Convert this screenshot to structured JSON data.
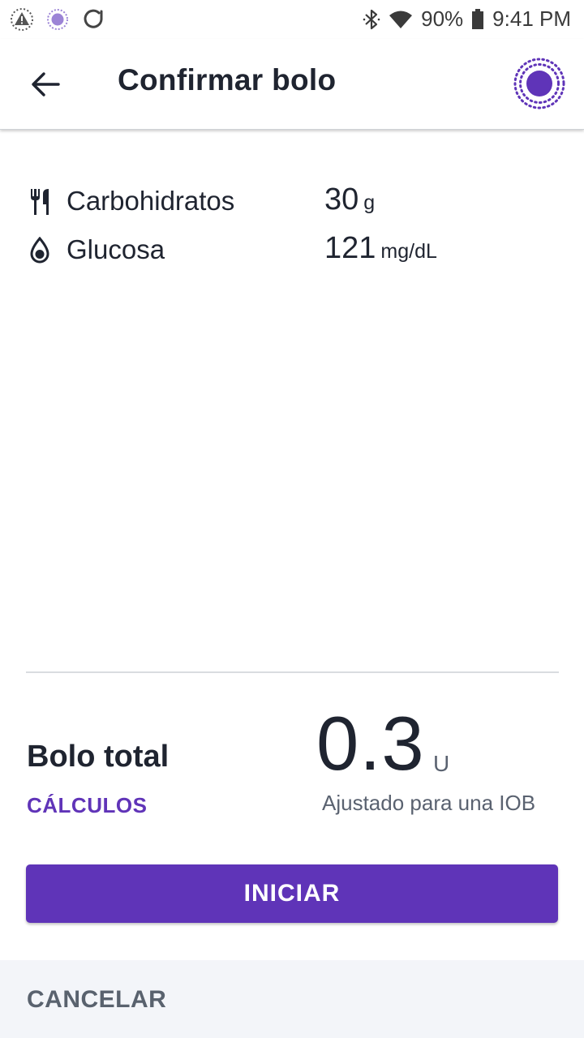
{
  "status_bar": {
    "battery": "90%",
    "time": "9:41 PM",
    "icons_left": [
      "warning-icon",
      "pod-status-icon",
      "sync-icon"
    ],
    "icons_right": [
      "bluetooth-icon",
      "wifi-icon",
      "battery-icon"
    ]
  },
  "header": {
    "title": "Confirmar bolo"
  },
  "inputs": {
    "carbs": {
      "label": "Carbohidratos",
      "value": "30",
      "unit": "g"
    },
    "glucose": {
      "label": "Glucosa",
      "value": "121",
      "unit": "mg/dL"
    }
  },
  "total": {
    "label": "Bolo total",
    "calculations_link": "CÁLCULOS",
    "value": "0.3",
    "unit": "U",
    "note": "Ajustado para una IOB"
  },
  "actions": {
    "start": "INICIAR",
    "cancel": "CANCELAR"
  },
  "colors": {
    "accent": "#5f34b8",
    "text": "#1f2430",
    "secondary_text": "#5a6270",
    "cancel_bar": "#f3f5f9"
  }
}
